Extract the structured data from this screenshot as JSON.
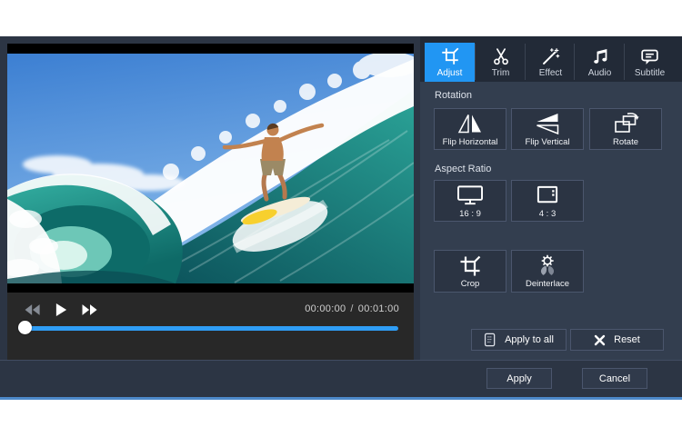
{
  "colors": {
    "accent_blue": "#2196f3",
    "slider_blue": "#2f9df5",
    "window_accent_line": "#4d89c9"
  },
  "player": {
    "current_time": "00:00:00",
    "separator": "/",
    "duration": "00:01:00",
    "transport": [
      {
        "name": "rewind",
        "icon": "rewind-icon"
      },
      {
        "name": "play",
        "icon": "play-icon"
      },
      {
        "name": "fast-forward",
        "icon": "fast-forward-icon"
      }
    ]
  },
  "tabs": [
    {
      "label": "Adjust",
      "icon": "crop-icon",
      "active": true
    },
    {
      "label": "Trim",
      "icon": "scissors-icon",
      "active": false
    },
    {
      "label": "Effect",
      "icon": "magic-wand-icon",
      "active": false
    },
    {
      "label": "Audio",
      "icon": "music-notes-icon",
      "active": false
    },
    {
      "label": "Subtitle",
      "icon": "speech-bubble-icon",
      "active": false
    }
  ],
  "panel": {
    "rotation": {
      "title": "Rotation",
      "buttons": [
        {
          "label": "Flip Horizontal",
          "icon": "flip-horizontal-icon"
        },
        {
          "label": "Flip Vertical",
          "icon": "flip-vertical-icon"
        },
        {
          "label": "Rotate",
          "icon": "rotate-icon"
        }
      ]
    },
    "aspect_ratio": {
      "title": "Aspect Ratio",
      "buttons": [
        {
          "label": "16 : 9",
          "icon": "widescreen-monitor-icon"
        },
        {
          "label": "4 : 3",
          "icon": "tv-4-3-icon"
        }
      ]
    },
    "tools": {
      "buttons": [
        {
          "label": "Crop",
          "icon": "crop-icon"
        },
        {
          "label": "Deinterlace",
          "icon": "deinterlace-icon"
        }
      ]
    },
    "actions": {
      "apply_to_all": {
        "label": "Apply to all",
        "icon": "document-icon"
      },
      "reset": {
        "label": "Reset",
        "icon": "x-icon"
      }
    }
  },
  "footer": {
    "apply": "Apply",
    "cancel": "Cancel"
  }
}
